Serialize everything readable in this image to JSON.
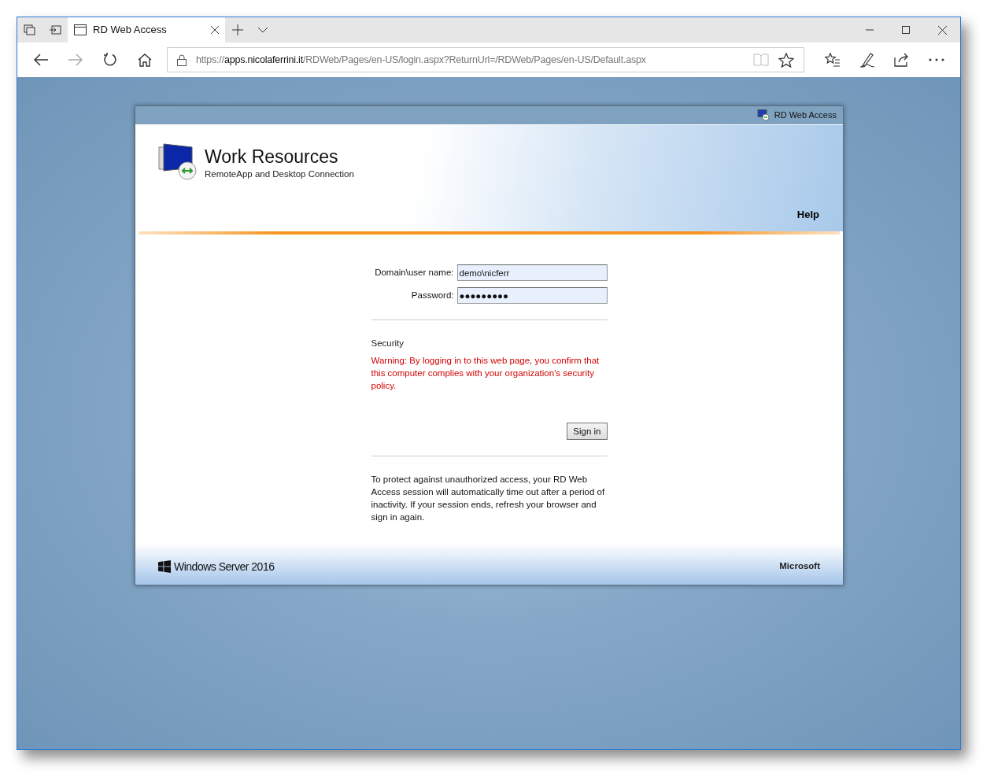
{
  "browser": {
    "tab": {
      "title": "RD Web Access",
      "selected": true
    },
    "address": {
      "scheme": "https://",
      "host": "apps.nicolaferrini.it",
      "path": "/RDWeb/Pages/en-US/login.aspx?ReturnUrl=/RDWeb/Pages/en-US/Default.aspx"
    }
  },
  "page": {
    "top_bar": {
      "label": "RD Web Access"
    },
    "header": {
      "title": "Work Resources",
      "subtitle": "RemoteApp and Desktop Connection",
      "help": "Help"
    },
    "form": {
      "fields": [
        {
          "label": "Domain\\user name:",
          "value": "demo\\nicferr"
        },
        {
          "label": "Password:",
          "value": "●●●●●●●●●"
        }
      ],
      "security_heading": "Security",
      "warning": "Warning: By logging in to this web page, you confirm that this computer complies with your organization's security policy.",
      "sign_in": "Sign in",
      "notice": "To protect against unauthorized access, your RD Web Access session will automatically time out after a period of inactivity. If your session ends, refresh your browser and sign in again."
    },
    "footer": {
      "product": "Windows Server 2016",
      "vendor": "Microsoft"
    }
  }
}
